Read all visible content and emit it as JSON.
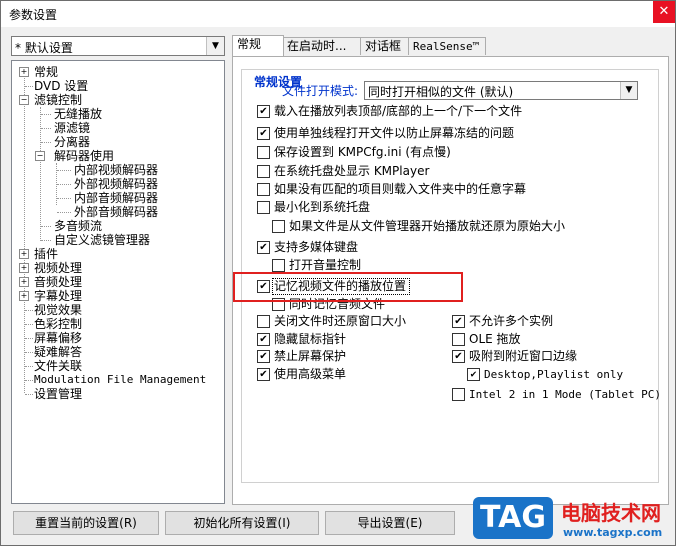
{
  "window": {
    "title": "参数设置",
    "close_glyph": "✕"
  },
  "profile": {
    "selected": "* 默认设置"
  },
  "tree": {
    "items": [
      {
        "label": "常规",
        "box": "+"
      },
      {
        "label": "DVD 设置"
      },
      {
        "label": "滤镜控制",
        "box": "−"
      },
      {
        "label": "无缝播放"
      },
      {
        "label": "源滤镜"
      },
      {
        "label": "分离器"
      },
      {
        "label": "解码器使用",
        "box": "−"
      },
      {
        "label": "内部视频解码器"
      },
      {
        "label": "外部视频解码器"
      },
      {
        "label": "内部音频解码器"
      },
      {
        "label": "外部音频解码器"
      },
      {
        "label": "多音频流"
      },
      {
        "label": "自定义滤镜管理器"
      },
      {
        "label": "插件",
        "box": "+"
      },
      {
        "label": "视频处理",
        "box": "+"
      },
      {
        "label": "音频处理",
        "box": "+"
      },
      {
        "label": "字幕处理",
        "box": "+"
      },
      {
        "label": "视觉效果"
      },
      {
        "label": "色彩控制"
      },
      {
        "label": "屏幕偏移"
      },
      {
        "label": "疑难解答"
      },
      {
        "label": "文件关联"
      },
      {
        "label": "Modulation File Management"
      },
      {
        "label": "设置管理"
      }
    ]
  },
  "tabs": [
    {
      "label": "常规"
    },
    {
      "label": "在启动时..."
    },
    {
      "label": "对话框"
    },
    {
      "label": "RealSense™"
    }
  ],
  "general": {
    "group_title": "常规设置",
    "open_mode_label": "文件打开模式:",
    "open_mode_value": "同时打开相似的文件 (默认)",
    "options": [
      {
        "label": "载入在播放列表顶部/底部的上一个/下一个文件",
        "checked": true
      },
      {
        "label": "使用单独线程打开文件以防止屏幕冻结的问题",
        "checked": true
      },
      {
        "label": "保存设置到 KMPCfg.ini (有点慢)",
        "checked": false
      },
      {
        "label": "在系统托盘处显示 KMPlayer",
        "checked": false
      },
      {
        "label": "如果没有匹配的项目则载入文件夹中的任意字幕",
        "checked": false
      },
      {
        "label": "最小化到系统托盘",
        "checked": false
      },
      {
        "label": "如果文件是从文件管理器开始播放就还原为原始大小",
        "checked": false
      },
      {
        "label": "支持多媒体键盘",
        "checked": true
      },
      {
        "label": "打开音量控制",
        "checked": false
      },
      {
        "label": "记忆视频文件的播放位置",
        "checked": true
      },
      {
        "label": "同时记忆音频文件",
        "checked": false
      },
      {
        "label": "关闭文件时还原窗口大小",
        "checked": false
      },
      {
        "label": "隐藏鼠标指针",
        "checked": true
      },
      {
        "label": "禁止屏幕保护",
        "checked": true
      },
      {
        "label": "使用高级菜单",
        "checked": true
      },
      {
        "label": "不允许多个实例",
        "checked": true
      },
      {
        "label": "OLE 拖放",
        "checked": false
      },
      {
        "label": "吸附到附近窗口边缘",
        "checked": true
      },
      {
        "label": "Desktop,Playlist only",
        "checked": true
      },
      {
        "label": "Intel 2 in 1 Mode (Tablet PC)",
        "checked": false
      }
    ]
  },
  "buttons": {
    "reset": "重置当前的设置(R)",
    "init_all": "初始化所有设置(I)",
    "export": "导出设置(E)"
  },
  "watermark": {
    "tag": "TAG",
    "text": "电脑技术网",
    "url": "www.tagxp.com"
  },
  "colors": {
    "accent_blue": "#0033cc",
    "highlight_red": "#e0201f",
    "tag_blue": "#1a73c8"
  }
}
